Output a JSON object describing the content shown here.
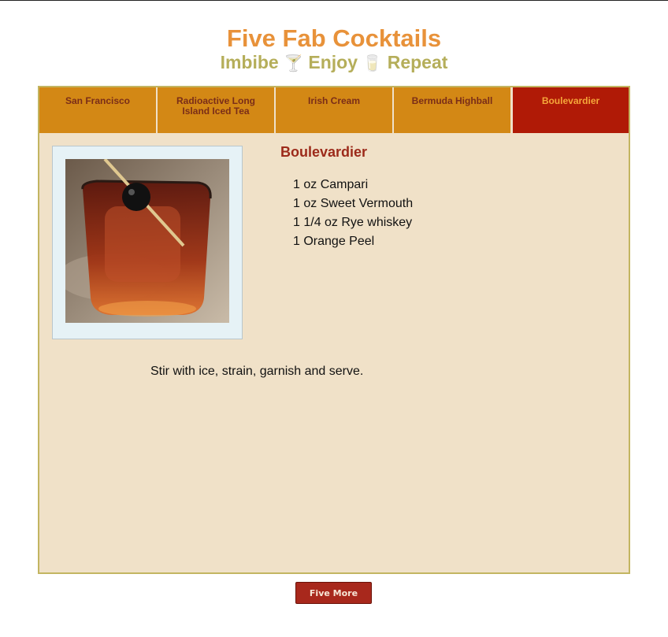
{
  "header": {
    "title": "Five Fab Cocktails",
    "subtitle_parts": [
      "Imbibe",
      "Enjoy",
      "Repeat"
    ],
    "glyph_1": "🍸",
    "glyph_2": "🥛"
  },
  "tabs": [
    {
      "label": "San Francisco",
      "active": false
    },
    {
      "label": "Radioactive Long Island Iced Tea",
      "active": false
    },
    {
      "label": "Irish Cream",
      "active": false
    },
    {
      "label": "Bermuda Highball",
      "active": false
    },
    {
      "label": "Boulevardier",
      "active": true
    }
  ],
  "recipe": {
    "name": "Boulevardier",
    "ingredients": [
      "1 oz Campari",
      "1 oz Sweet Vermouth",
      "1 1/4 oz Rye whiskey",
      "1 Orange Peel"
    ],
    "method": "Stir with ice, strain, garnish and serve.",
    "image_subject": "cocktail-glass-photo"
  },
  "footer": {
    "button_label": "Five More"
  },
  "colors": {
    "title": "#e8923a",
    "subtitle": "#b5ae5a",
    "tab": "#d38815",
    "tab_active": "#b01a06",
    "panel": "#f0e1c8",
    "button": "#a8281c"
  }
}
